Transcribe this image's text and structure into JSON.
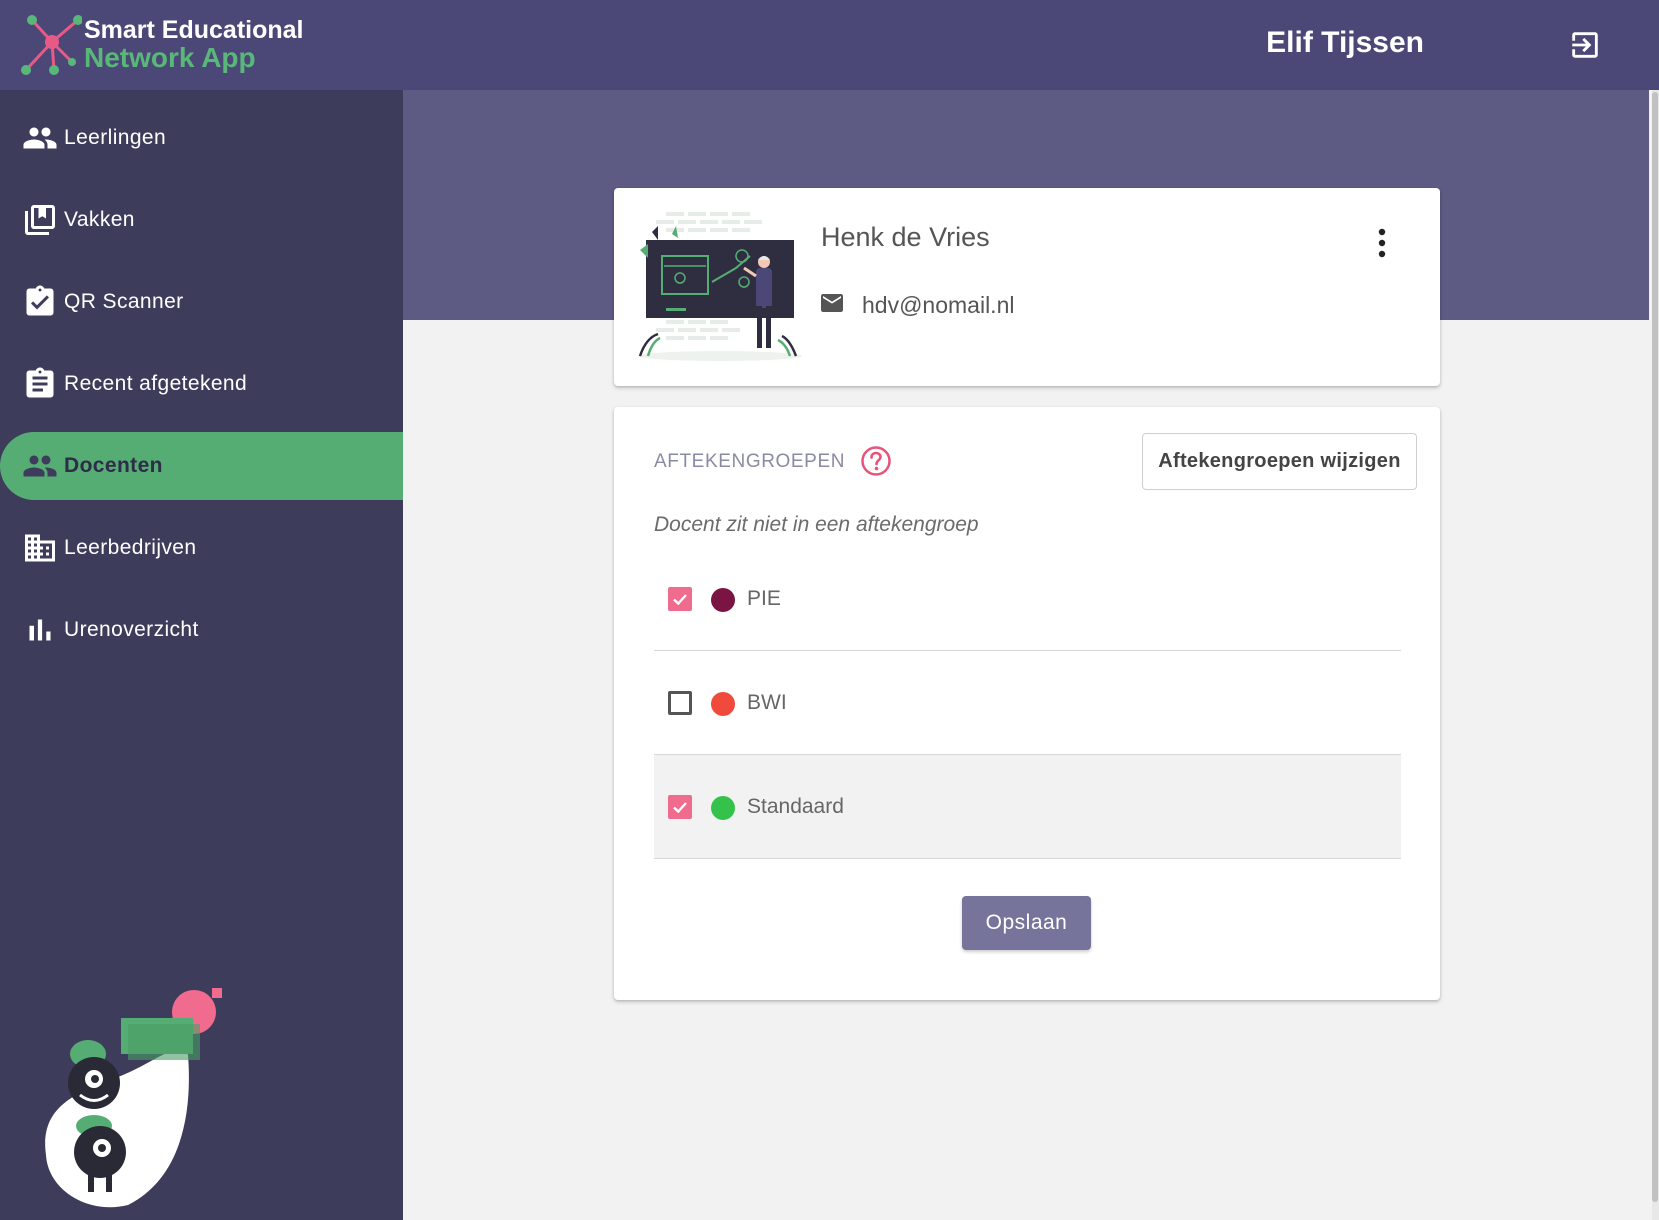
{
  "app": {
    "title_line1": "Smart Educational",
    "title_line2": "Network App",
    "user_name": "Elif Tijssen"
  },
  "colors": {
    "header_bg": "#4b4878",
    "sidebar_bg": "#3e3c5b",
    "accent_green": "#56ad74",
    "checkbox_pink": "#f06b8e",
    "save_button": "#77749c"
  },
  "sidebar": {
    "items": [
      {
        "label": "Leerlingen",
        "icon": "people-icon",
        "active": false
      },
      {
        "label": "Vakken",
        "icon": "library-books-icon",
        "active": false
      },
      {
        "label": "QR Scanner",
        "icon": "clipboard-check-icon",
        "active": false
      },
      {
        "label": "Recent afgetekend",
        "icon": "clipboard-list-icon",
        "active": false
      },
      {
        "label": "Docenten",
        "icon": "people-icon",
        "active": true
      },
      {
        "label": "Leerbedrijven",
        "icon": "building-icon",
        "active": false
      },
      {
        "label": "Urenoverzicht",
        "icon": "bar-chart-icon",
        "active": false
      }
    ]
  },
  "teacher": {
    "name": "Henk de Vries",
    "email": "hdv@nomail.nl"
  },
  "groups_section": {
    "title": "AFTEKENGROEPEN",
    "edit_label": "Aftekengroepen wijzigen",
    "empty_text": "Docent zit niet in een aftekengroep",
    "save_label": "Opslaan",
    "groups": [
      {
        "name": "PIE",
        "color": "#7a1543",
        "checked": true
      },
      {
        "name": "BWI",
        "color": "#f04a3c",
        "checked": false
      },
      {
        "name": "Standaard",
        "color": "#35c24a",
        "checked": true
      }
    ]
  }
}
